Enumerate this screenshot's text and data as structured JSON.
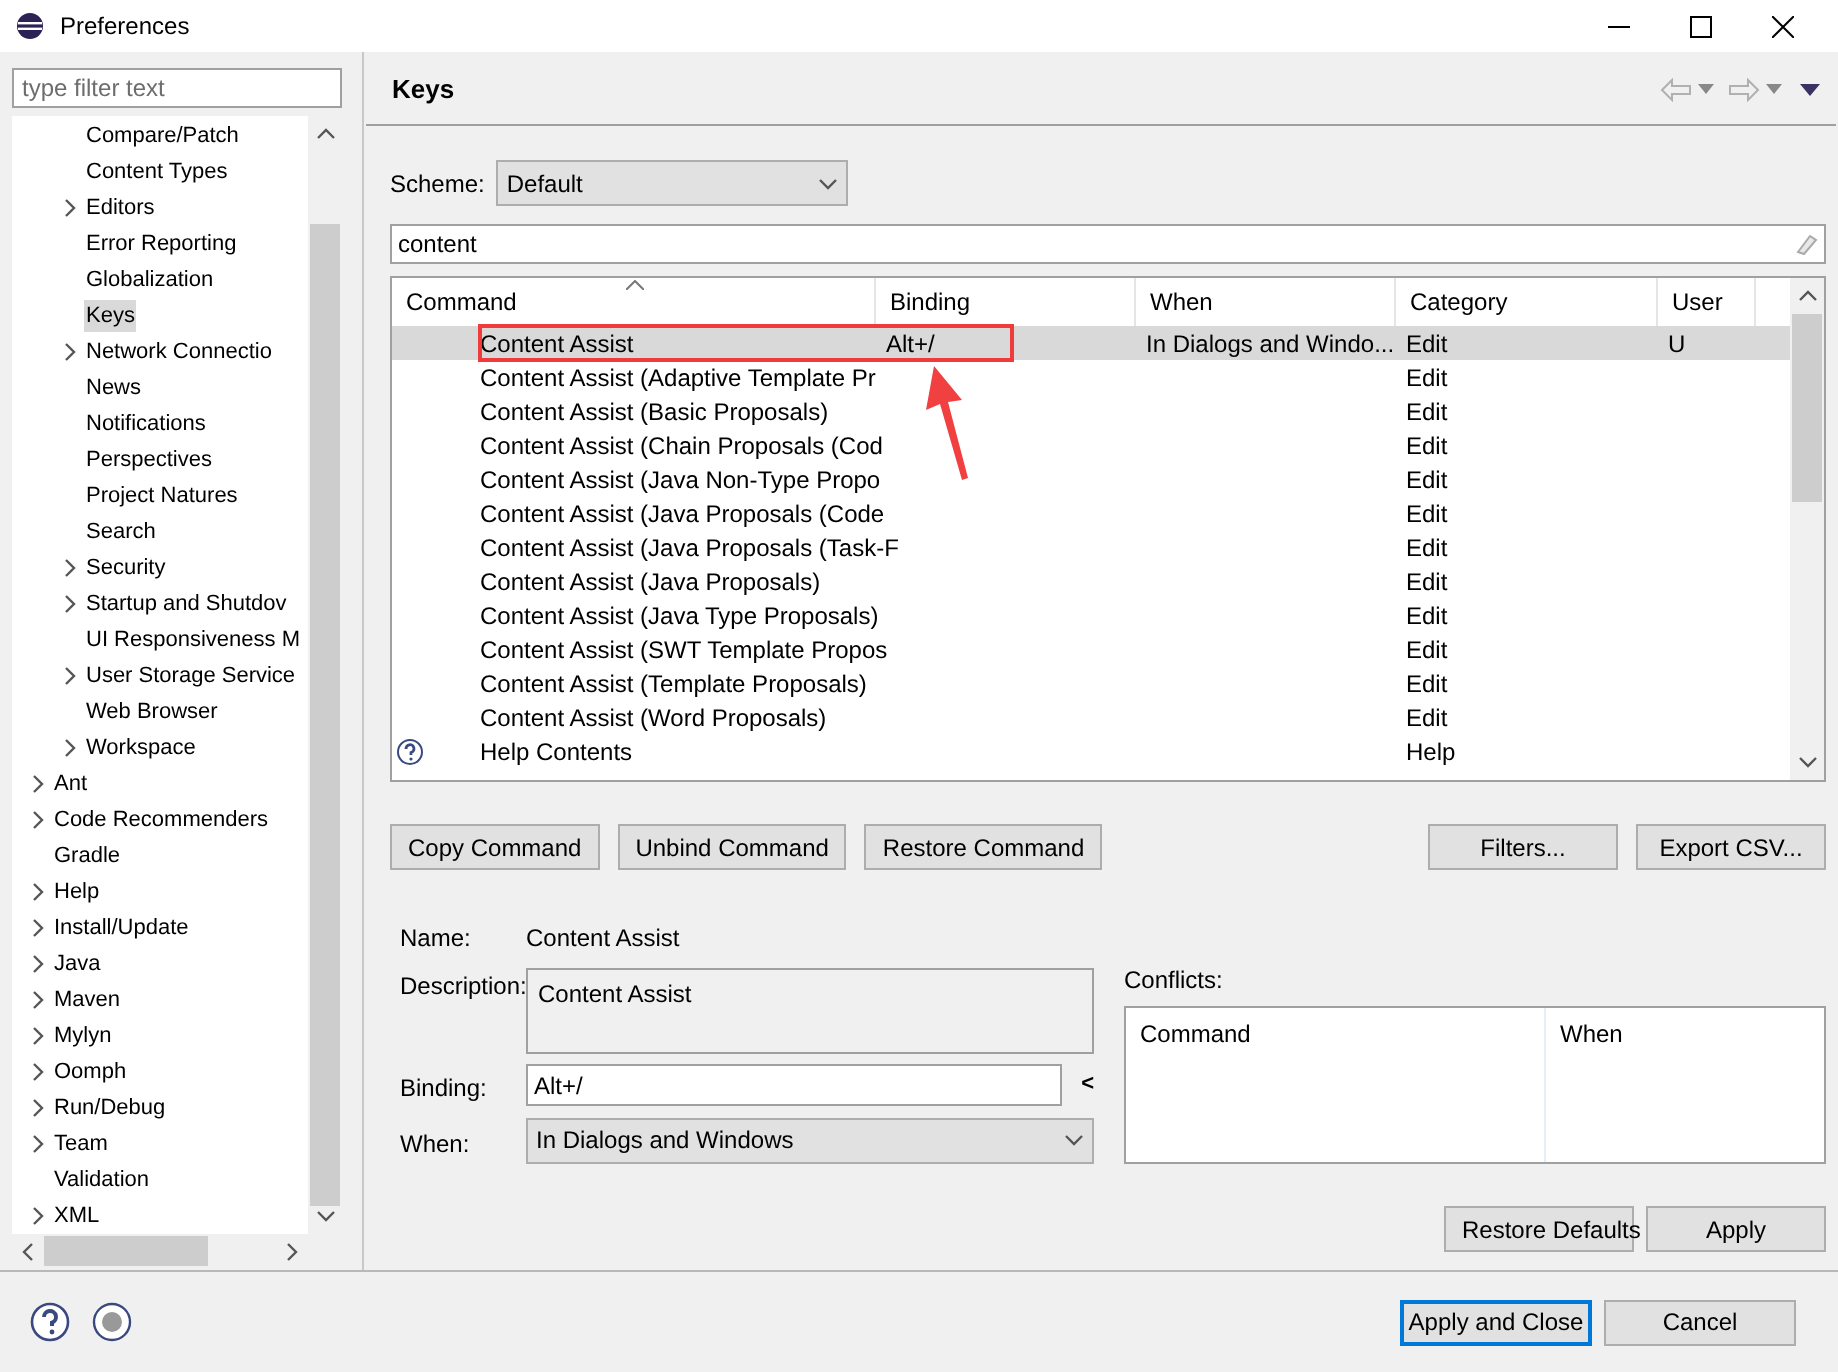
{
  "window": {
    "title": "Preferences"
  },
  "filter": {
    "placeholder": "type filter text"
  },
  "tree": {
    "nested_items": [
      {
        "label": "Compare/Patch",
        "expandable": false,
        "selected": false
      },
      {
        "label": "Content Types",
        "expandable": false,
        "selected": false
      },
      {
        "label": "Editors",
        "expandable": true,
        "selected": false
      },
      {
        "label": "Error Reporting",
        "expandable": false,
        "selected": false
      },
      {
        "label": "Globalization",
        "expandable": false,
        "selected": false
      },
      {
        "label": "Keys",
        "expandable": false,
        "selected": true
      },
      {
        "label": "Network Connectio",
        "expandable": true,
        "selected": false
      },
      {
        "label": "News",
        "expandable": false,
        "selected": false
      },
      {
        "label": "Notifications",
        "expandable": false,
        "selected": false
      },
      {
        "label": "Perspectives",
        "expandable": false,
        "selected": false
      },
      {
        "label": "Project Natures",
        "expandable": false,
        "selected": false
      },
      {
        "label": "Search",
        "expandable": false,
        "selected": false
      },
      {
        "label": "Security",
        "expandable": true,
        "selected": false
      },
      {
        "label": "Startup and Shutdov",
        "expandable": true,
        "selected": false
      },
      {
        "label": "UI Responsiveness M",
        "expandable": false,
        "selected": false
      },
      {
        "label": "User Storage Service",
        "expandable": true,
        "selected": false
      },
      {
        "label": "Web Browser",
        "expandable": false,
        "selected": false
      },
      {
        "label": "Workspace",
        "expandable": true,
        "selected": false
      }
    ],
    "items": [
      {
        "label": "Ant",
        "expandable": true,
        "selected": false
      },
      {
        "label": "Code Recommenders",
        "expandable": true,
        "selected": false
      },
      {
        "label": "Gradle",
        "expandable": false,
        "selected": false
      },
      {
        "label": "Help",
        "expandable": true,
        "selected": false
      },
      {
        "label": "Install/Update",
        "expandable": true,
        "selected": false
      },
      {
        "label": "Java",
        "expandable": true,
        "selected": false
      },
      {
        "label": "Maven",
        "expandable": true,
        "selected": false
      },
      {
        "label": "Mylyn",
        "expandable": true,
        "selected": false
      },
      {
        "label": "Oomph",
        "expandable": true,
        "selected": false
      },
      {
        "label": "Run/Debug",
        "expandable": true,
        "selected": false
      },
      {
        "label": "Team",
        "expandable": true,
        "selected": false
      },
      {
        "label": "Validation",
        "expandable": false,
        "selected": false
      },
      {
        "label": "XML",
        "expandable": true,
        "selected": false
      }
    ]
  },
  "page": {
    "title": "Keys",
    "scheme": {
      "label": "Scheme:",
      "value": "Default"
    },
    "search": {
      "value": "content"
    },
    "table": {
      "columns": [
        "Command",
        "Binding",
        "When",
        "Category",
        "User"
      ],
      "rows": [
        {
          "kind": "command",
          "command": "Content Assist",
          "binding": "Alt+/",
          "when": "In Dialogs and Windo...",
          "category": "Edit",
          "user": "U",
          "selected": true
        },
        {
          "kind": "command",
          "command": "Content Assist (Adaptive Template Pr",
          "category": "Edit",
          "selected": false
        },
        {
          "kind": "command",
          "command": "Content Assist (Basic Proposals)",
          "category": "Edit",
          "selected": false
        },
        {
          "kind": "command",
          "command": "Content Assist (Chain Proposals (Cod",
          "category": "Edit",
          "selected": false
        },
        {
          "kind": "command",
          "command": "Content Assist (Java Non-Type Propo",
          "category": "Edit",
          "selected": false
        },
        {
          "kind": "command",
          "command": "Content Assist (Java Proposals (Code",
          "category": "Edit",
          "selected": false
        },
        {
          "kind": "command",
          "command": "Content Assist (Java Proposals (Task-F",
          "category": "Edit",
          "selected": false
        },
        {
          "kind": "command",
          "command": "Content Assist (Java Proposals)",
          "category": "Edit",
          "selected": false
        },
        {
          "kind": "command",
          "command": "Content Assist (Java Type Proposals)",
          "category": "Edit",
          "selected": false
        },
        {
          "kind": "command",
          "command": "Content Assist (SWT Template Propos",
          "category": "Edit",
          "selected": false
        },
        {
          "kind": "command",
          "command": "Content Assist (Template Proposals)",
          "category": "Edit",
          "selected": false
        },
        {
          "kind": "command",
          "command": "Content Assist (Word Proposals)",
          "category": "Edit",
          "selected": false
        },
        {
          "kind": "help",
          "command": "Help Contents",
          "category": "Help",
          "selected": false
        }
      ]
    },
    "table_buttons": [
      "Copy Command",
      "Unbind Command",
      "Restore Command"
    ],
    "right_buttons": [
      "Filters...",
      "Export CSV..."
    ],
    "details": {
      "name_label": "Name:",
      "name": "Content Assist",
      "description_label": "Description:",
      "description": "Content Assist",
      "binding_label": "Binding:",
      "binding": "Alt+/",
      "binding_menu": "<",
      "when_label": "When:",
      "when": "In Dialogs and Windows"
    },
    "conflicts": {
      "label": "Conflicts:",
      "columns": [
        "Command",
        "When"
      ]
    },
    "page_buttons": [
      "Restore Defaults",
      "Apply"
    ]
  },
  "dialog_buttons": [
    {
      "label": "Apply and Close",
      "default": true
    },
    {
      "label": "Cancel",
      "default": false
    }
  ]
}
